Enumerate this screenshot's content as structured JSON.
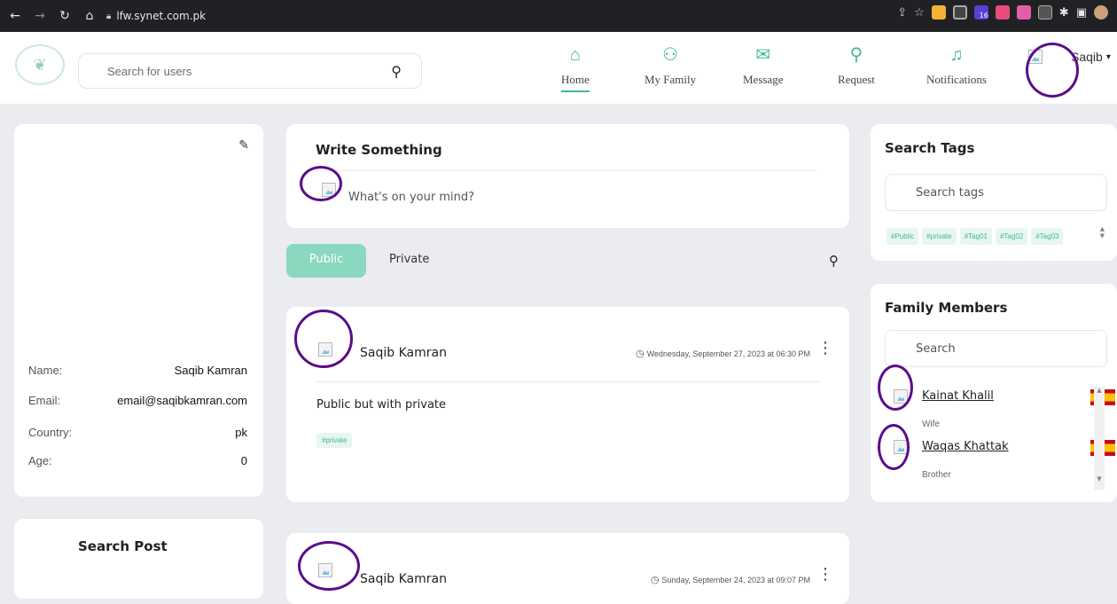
{
  "browser": {
    "url": "lfw.synet.com.pk",
    "badge": "16"
  },
  "header": {
    "search_placeholder": "Search for users",
    "nav": [
      {
        "label": "Home",
        "icon": "home-icon"
      },
      {
        "label": "My Family",
        "icon": "family-tree-icon"
      },
      {
        "label": "Message",
        "icon": "message-icon"
      },
      {
        "label": "Request",
        "icon": "add-user-icon"
      },
      {
        "label": "Notifications",
        "icon": "bell-icon"
      }
    ],
    "username": "Saqib",
    "accent": "#3fb99a"
  },
  "profile": {
    "rows": [
      {
        "key": "Name:",
        "value": "Saqib Kamran"
      },
      {
        "key": "Email:",
        "value": "email@saqibkamran.com"
      },
      {
        "key": "Country:",
        "value": "pk"
      },
      {
        "key": "Age:",
        "value": "0"
      }
    ]
  },
  "search_post": {
    "title": "Search Post"
  },
  "composer": {
    "title": "Write Something",
    "placeholder": "What's on your mind?"
  },
  "tabs": {
    "public": "Public",
    "private": "Private"
  },
  "posts": [
    {
      "author": "Saqib Kamran",
      "time": "Wednesday, September 27, 2023 at 06:30 PM",
      "body": "Public but with private",
      "tag": "#private"
    },
    {
      "author": "Saqib Kamran",
      "time": "Sunday, September 24, 2023 at 09:07 PM"
    }
  ],
  "search_tags": {
    "title": "Search Tags",
    "placeholder": "Search tags",
    "tags": [
      "#Public",
      "#private",
      "#Tag01",
      "#Tag02",
      "#Tag03"
    ]
  },
  "family": {
    "title": "Family Members",
    "placeholder": "Search",
    "members": [
      {
        "name": "Kainat Khalil",
        "relation": "Wife"
      },
      {
        "name": "Waqas Khattak",
        "relation": "Brother"
      }
    ]
  }
}
